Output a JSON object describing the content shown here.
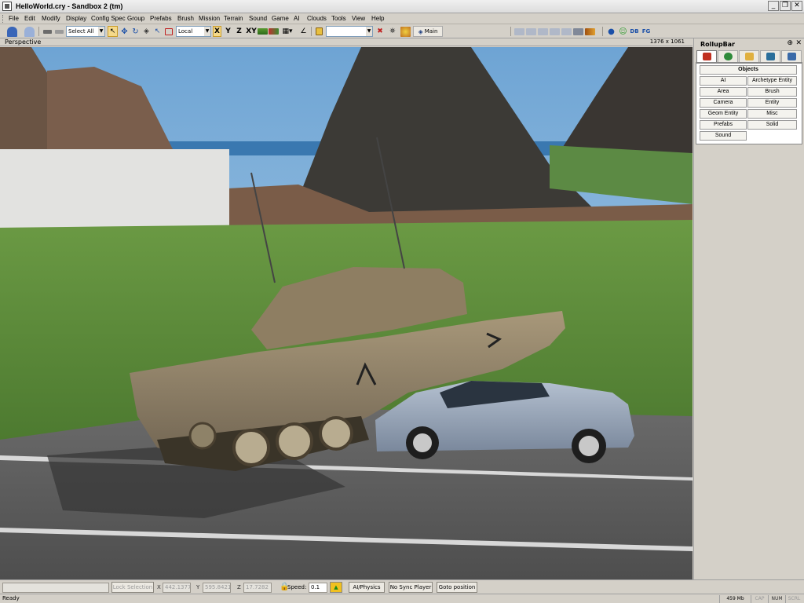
{
  "window": {
    "title": "HelloWorld.cry - Sandbox 2 (tm)"
  },
  "menu": [
    "File",
    "Edit",
    "Modify",
    "Display",
    "Config Spec",
    "Group",
    "Prefabs",
    "Brush",
    "Mission",
    "Terrain",
    "Sound",
    "Game",
    "AI",
    "Clouds",
    "Tools",
    "View",
    "Help"
  ],
  "toolbar": {
    "selection_combo": "Select All",
    "coord_combo": "Local",
    "axes": [
      "X",
      "Y",
      "Z",
      "XY"
    ],
    "layer_label": "Main",
    "db_label": "DB",
    "fg_label": "FG"
  },
  "viewport": {
    "label": "Perspective",
    "resolution": "1376 x 1061"
  },
  "rollup": {
    "title": "RollupBar",
    "objects_button": "Objects",
    "buttons": [
      "AI",
      "Archetype Entity",
      "Area",
      "Brush",
      "Camera",
      "Entity",
      "Geom Entity",
      "Misc",
      "Prefabs",
      "Solid",
      "Sound"
    ]
  },
  "bottom": {
    "lock_selection": "Lock Selection",
    "x_label": "X",
    "x_value": "442.1377",
    "y_label": "Y",
    "y_value": "595.8421",
    "z_label": "Z",
    "z_value": "17.7282",
    "speed_label": "Speed:",
    "speed_value": "0.1",
    "ai_physics": "AI/Physics",
    "no_sync": "No Sync Player",
    "goto": "Goto position"
  },
  "status": {
    "text": "Ready",
    "memory": "459 Mb",
    "cap": "CAP",
    "num": "NUM",
    "scrl": "SCRL"
  },
  "colors": {
    "accent": "#316ac5",
    "sky": "#7bb0d8",
    "grass": "#5f8c3c",
    "road": "#5d5d5d",
    "car": "#8c9aae",
    "tank": "#8a7b60"
  }
}
